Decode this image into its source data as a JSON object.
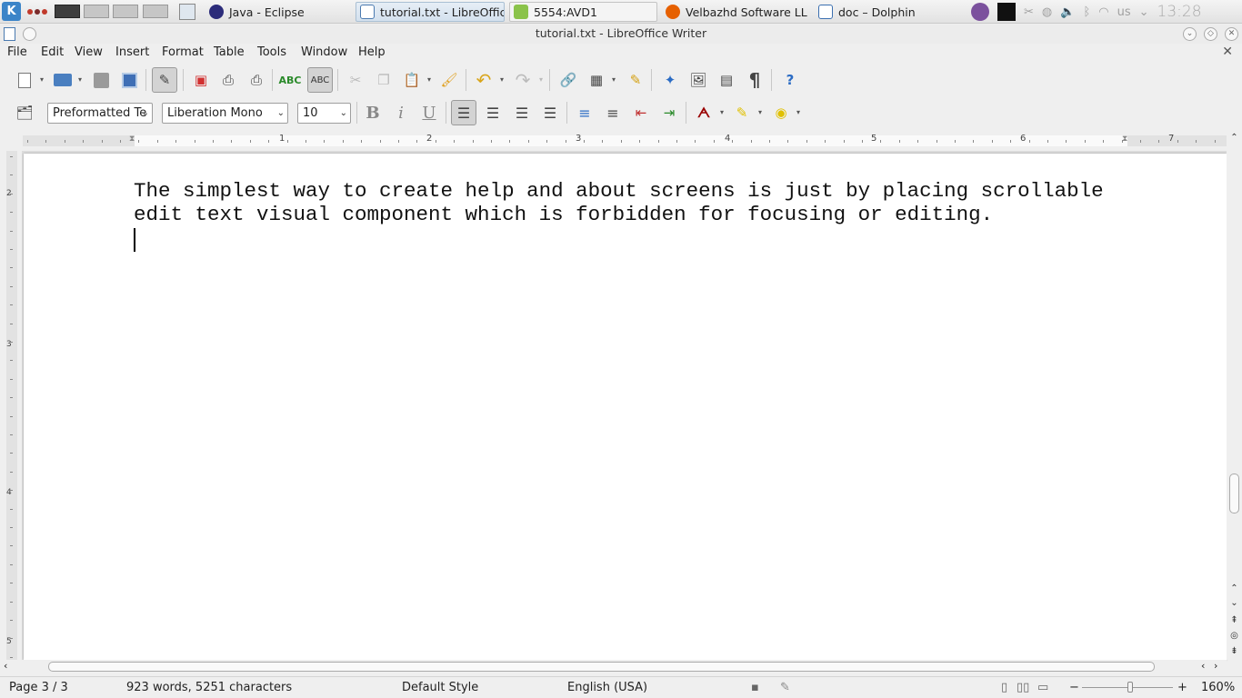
{
  "taskbar": {
    "tasks": [
      {
        "label": "Java - Eclipse"
      },
      {
        "label": "tutorial.txt - LibreOffic"
      },
      {
        "label": "5554:AVD1"
      },
      {
        "label": "Velbazhd Software LLC"
      },
      {
        "label": "doc – Dolphin"
      }
    ],
    "tray_icons": [
      "viber-icon",
      "dropbox-icon",
      "klipper-icon",
      "network-icon",
      "volume-icon",
      "bluetooth-icon",
      "wifi-icon"
    ],
    "keyboard_layout": "us",
    "clock": "13:28"
  },
  "window": {
    "title": "tutorial.txt - LibreOffice Writer"
  },
  "menu": {
    "items": [
      "File",
      "Edit",
      "View",
      "Insert",
      "Format",
      "Table",
      "Tools",
      "Window",
      "Help"
    ]
  },
  "formatting": {
    "paragraph_style": "Preformatted Te",
    "font_name": "Liberation Mono",
    "font_size": "10"
  },
  "ruler": {
    "h_numbers": [
      "1",
      "2",
      "3",
      "4",
      "5",
      "6",
      "7"
    ],
    "v_numbers": [
      "2",
      "3",
      "4",
      "5"
    ]
  },
  "document": {
    "text": "The simplest way to create help and about screens is just by placing scrollable\nedit text visual component which is forbidden for focusing or editing."
  },
  "status": {
    "page": "Page 3 / 3",
    "words": "923 words, 5251 characters",
    "style": "Default Style",
    "language": "English (USA)",
    "zoom": "160%"
  },
  "colors": {
    "accent": "#3b84c8",
    "ruler_margin": "#e2e2e2"
  }
}
